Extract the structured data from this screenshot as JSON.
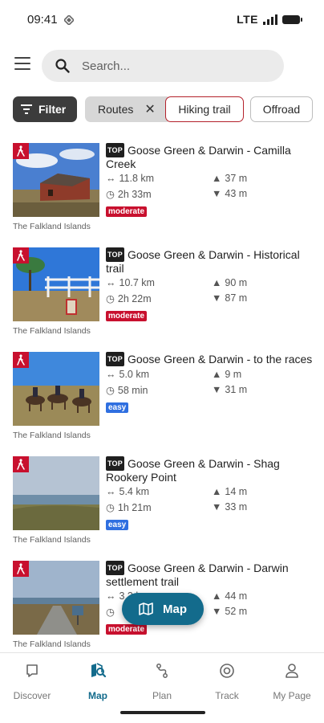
{
  "status_bar": {
    "time": "09:41",
    "network": "LTE"
  },
  "search": {
    "placeholder": "Search..."
  },
  "chips": {
    "filter": "Filter",
    "routes": "Routes",
    "hiking": "Hiking trail",
    "offroad": "Offroad"
  },
  "tours": [
    {
      "top_label": "TOP",
      "title": "Goose Green & Darwin - Camilla Creek",
      "distance": "11.8 km",
      "duration": "2h 33m",
      "ascent": "37 m",
      "descent": "43 m",
      "difficulty": "moderate",
      "region": "The Falkland Islands",
      "photo": "red-barn"
    },
    {
      "top_label": "TOP",
      "title": "Goose Green & Darwin - Historical trail",
      "distance": "10.7 km",
      "duration": "2h 22m",
      "ascent": "90 m",
      "descent": "87 m",
      "difficulty": "moderate",
      "region": "The Falkland Islands",
      "photo": "fence-tree"
    },
    {
      "top_label": "TOP",
      "title": "Goose Green & Darwin - to the races",
      "distance": "5.0 km",
      "duration": "58 min",
      "ascent": "9 m",
      "descent": "31 m",
      "difficulty": "easy",
      "region": "The Falkland Islands",
      "photo": "horse-riders"
    },
    {
      "top_label": "TOP",
      "title": "Goose Green & Darwin - Shag Rookery Point",
      "distance": "5.4 km",
      "duration": "1h 21m",
      "ascent": "14 m",
      "descent": "33 m",
      "difficulty": "easy",
      "region": "The Falkland Islands",
      "photo": "coast"
    },
    {
      "top_label": "TOP",
      "title": "Goose Green & Darwin - Darwin settlement trail",
      "distance": "3.3 km",
      "duration": "",
      "ascent": "44 m",
      "descent": "52 m",
      "difficulty": "moderate",
      "region": "The Falkland Islands",
      "photo": "road-sign"
    }
  ],
  "map_fab": {
    "label": "Map"
  },
  "nav": [
    {
      "label": "Discover",
      "icon": "discover-icon"
    },
    {
      "label": "Map",
      "icon": "map-nav-icon",
      "active": true
    },
    {
      "label": "Plan",
      "icon": "plan-icon"
    },
    {
      "label": "Track",
      "icon": "track-icon"
    },
    {
      "label": "My Page",
      "icon": "person-icon"
    }
  ],
  "colors": {
    "brand": "#136b8c",
    "moderate": "#c8102e",
    "easy": "#2f6fe0",
    "hike_badge": "#c8102e"
  }
}
